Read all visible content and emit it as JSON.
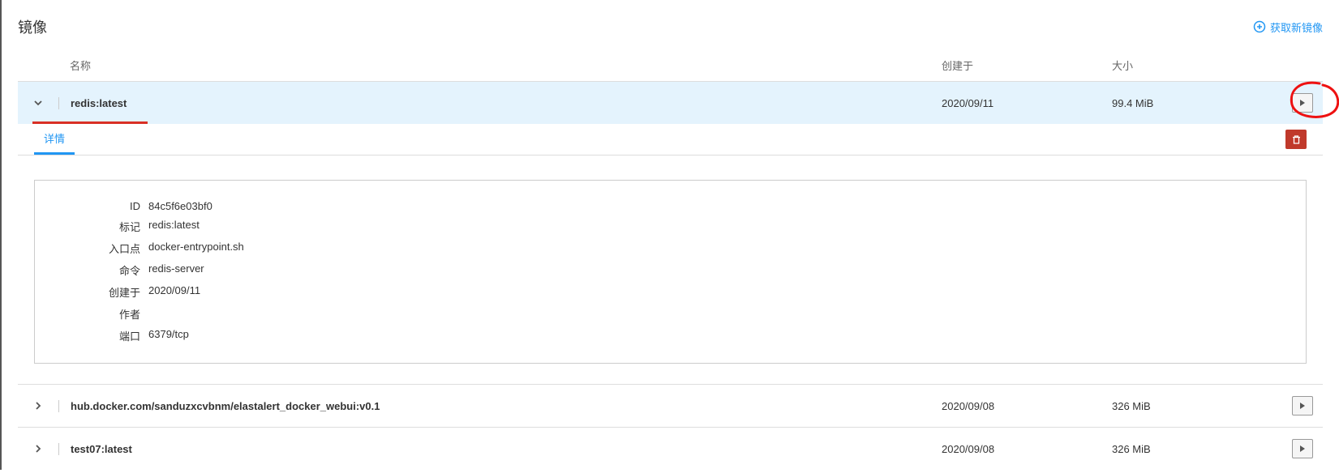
{
  "header": {
    "title": "镜像",
    "new_image_label": "获取新镜像"
  },
  "columns": {
    "name": "名称",
    "created": "创建于",
    "size": "大小"
  },
  "rows": [
    {
      "name": "redis:latest",
      "created": "2020/09/11",
      "size": "99.4 MiB",
      "expanded": true
    },
    {
      "name": "hub.docker.com/sanduzxcvbnm/elastalert_docker_webui:v0.1",
      "created": "2020/09/08",
      "size": "326 MiB",
      "expanded": false
    },
    {
      "name": "test07:latest",
      "created": "2020/09/08",
      "size": "326 MiB",
      "expanded": false
    }
  ],
  "details_tab": "详情",
  "details": {
    "labels": {
      "id": "ID",
      "tag": "标记",
      "entrypoint": "入口点",
      "command": "命令",
      "created": "创建于",
      "author": "作者",
      "port": "端口"
    },
    "values": {
      "id": "84c5f6e03bf0",
      "tag": "redis:latest",
      "entrypoint": "docker-entrypoint.sh",
      "command": "redis-server",
      "created": "2020/09/11",
      "author": "",
      "port": "6379/tcp"
    }
  }
}
